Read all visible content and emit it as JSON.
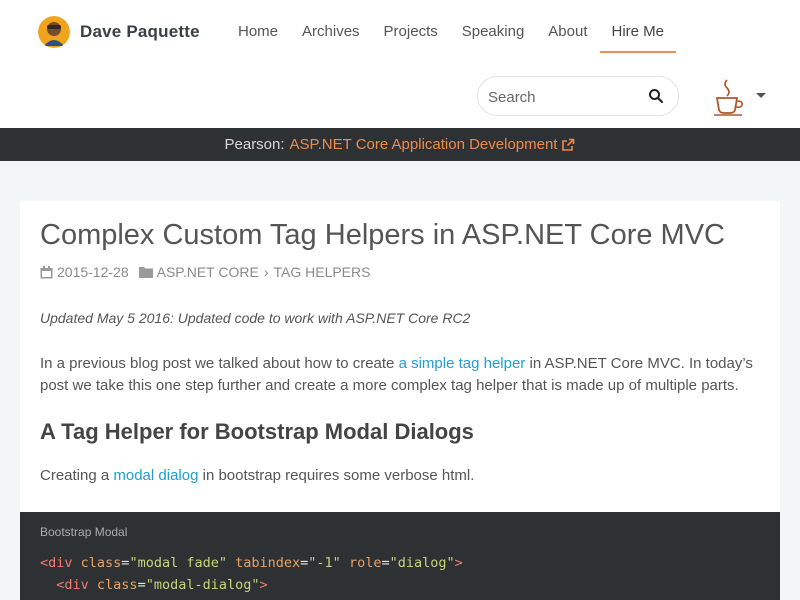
{
  "header": {
    "brand_name": "Dave Paquette",
    "nav": [
      {
        "label": "Home",
        "active": false
      },
      {
        "label": "Archives",
        "active": false
      },
      {
        "label": "Projects",
        "active": false
      },
      {
        "label": "Speaking",
        "active": false
      },
      {
        "label": "About",
        "active": false
      },
      {
        "label": "Hire Me",
        "active": true
      }
    ],
    "search_placeholder": "Search",
    "search_icon": "search-icon",
    "menu_icon": "coffee-cup-icon",
    "accent_color": "#e98e55"
  },
  "promo": {
    "prefix": "Pearson:",
    "link_text": "ASP.NET Core Application Development",
    "link_icon": "external-link-icon",
    "link_color": "#f08a4b"
  },
  "post": {
    "title": "Complex Custom Tag Helpers in ASP.NET Core MVC",
    "date": "2015-12-28",
    "date_icon": "calendar-icon",
    "category_icon": "folder-icon",
    "category": "ASP.NET CORE",
    "subcategory": "TAG HELPERS",
    "breadcrumb_sep": "›",
    "updated_note": "Updated May 5 2016: Updated code to work with ASP.NET Core RC2",
    "intro_before": "In a previous blog post we talked about how to create ",
    "intro_link": "a simple tag helper",
    "intro_after": " in ASP.NET Core MVC. In today’s post we take this one step further and create a more complex tag helper that is made up of multiple parts.",
    "heading": "A Tag Helper for Bootstrap Modal Dialogs",
    "p2_before": "Creating a ",
    "p2_link": "modal dialog",
    "p2_after": " in bootstrap requires some verbose html.",
    "link_color": "#1e9fd4"
  },
  "code": {
    "title": "Bootstrap Modal",
    "line1": {
      "open": "<div",
      "attr1": "class",
      "val1": "\"modal fade\"",
      "attr2": "tabindex",
      "val2": "\"-1\"",
      "attr3": "role",
      "val3": "\"dialog\"",
      "close": ">"
    },
    "line2": {
      "indent": "  ",
      "open": "<div",
      "attr1": "class",
      "val1": "\"modal-dialog\"",
      "close": ">"
    }
  }
}
